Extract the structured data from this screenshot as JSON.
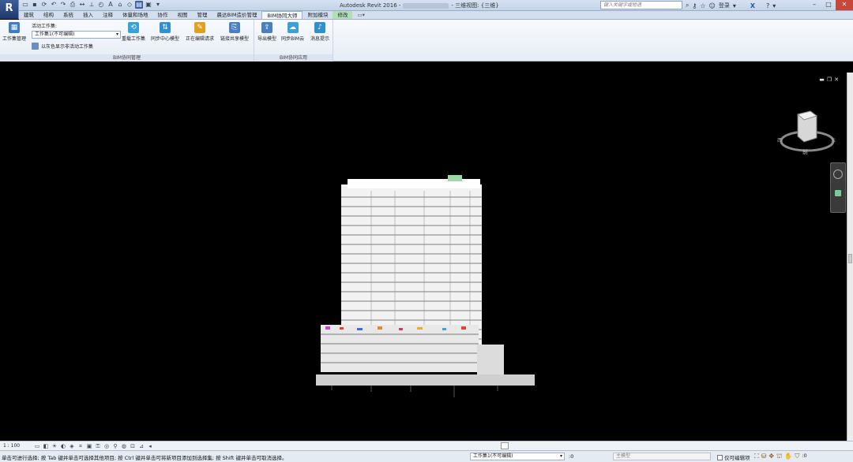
{
  "app": {
    "logo": "R",
    "title_prefix": "Autodesk Revit 2016 -",
    "title_suffix": "- 三维视图: {三维}"
  },
  "search": {
    "placeholder": "键入关键字或短语"
  },
  "title_right": {
    "login_label": "登录",
    "help_label": "?"
  },
  "tabs": [
    {
      "label": "建筑"
    },
    {
      "label": "结构"
    },
    {
      "label": "系统"
    },
    {
      "label": "插入"
    },
    {
      "label": "注释"
    },
    {
      "label": "体量和场地"
    },
    {
      "label": "协作"
    },
    {
      "label": "视图"
    },
    {
      "label": "管理"
    },
    {
      "label": "晨达BIM造价管理"
    },
    {
      "label": "BIM协同大师"
    },
    {
      "label": "附加模块"
    },
    {
      "label": "修改"
    }
  ],
  "ribbon": {
    "workset_mgr_label": "工作集管理",
    "active_workset_label": "活动工作集:",
    "active_workset_value": "工作集1(不可编辑)",
    "gray_inactive_label": "以灰色显示非活动工作集",
    "btn_reload": "重载工作集",
    "btn_sync_center": "同步中心模型",
    "btn_editing_request": "正在编辑请求",
    "btn_link_shared": "链接共享模型",
    "btn_export": "导出模型",
    "btn_sync_cloud": "同步BIM云",
    "btn_message": "消息提示",
    "panel_manage": "BIM协同管理",
    "panel_apply": "BIM协同应用"
  },
  "viewcube": {
    "face_label": "前",
    "compass_left": "西",
    "compass_right": "东"
  },
  "view_bar": {
    "scale": "1 : 100"
  },
  "status": {
    "text": "单击可进行选择; 按 Tab 键并单击可选择其他项目; 按 Ctrl 键并单击可将新项目添加到选择集; 按 Shift 键并单击可取消选择。",
    "workset": "工作集1(不可编辑)",
    "zero": ":0",
    "main_model": "主模型",
    "editable_only": "仅可编辑项"
  },
  "colors": {
    "viewport_bg": "#000000",
    "active_tab": "#f4f7fb",
    "ribbon_bg": "#eef3f9"
  }
}
